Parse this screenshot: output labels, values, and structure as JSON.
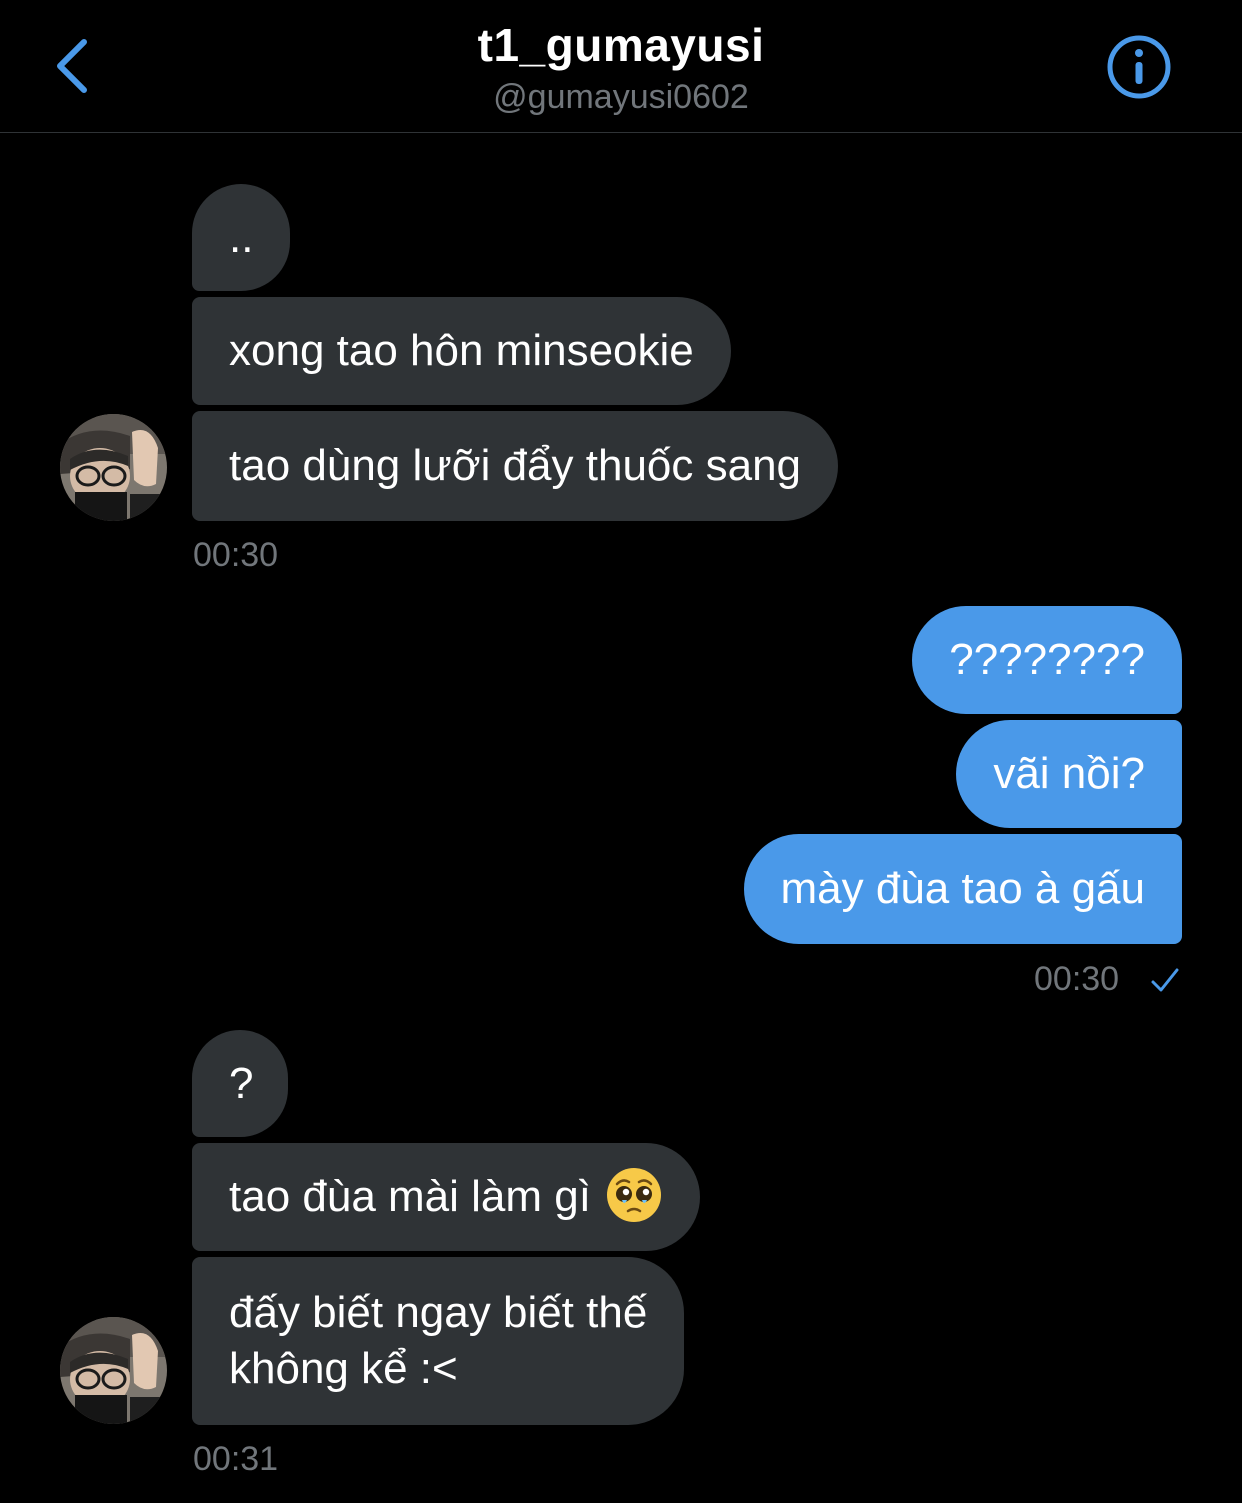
{
  "header": {
    "title": "t1_gumayusi",
    "handle": "@gumayusi0602"
  },
  "colors": {
    "accent": "#4a99e9",
    "incoming_bubble": "#2f3336",
    "muted_text": "#71767b"
  },
  "icons": {
    "back": "chevron-left-icon",
    "info": "info-circle-icon",
    "read": "checkmark-icon",
    "emoji": "pleading-face-emoji"
  },
  "messages": {
    "group1": {
      "m1": "..",
      "m2": "xong tao hôn minseokie",
      "m3": "tao dùng lưỡi đẩy thuốc sang",
      "time": "00:30"
    },
    "group2": {
      "m1": "????????",
      "m2": "vãi nồi?",
      "m3": "mày đùa tao à gấu",
      "time": "00:30"
    },
    "group3": {
      "m1": "?",
      "m2": "tao đùa mài làm gì",
      "m3_line1": "đấy biết ngay biết thế",
      "m3_line2": "không kể :<",
      "time": "00:31"
    }
  }
}
